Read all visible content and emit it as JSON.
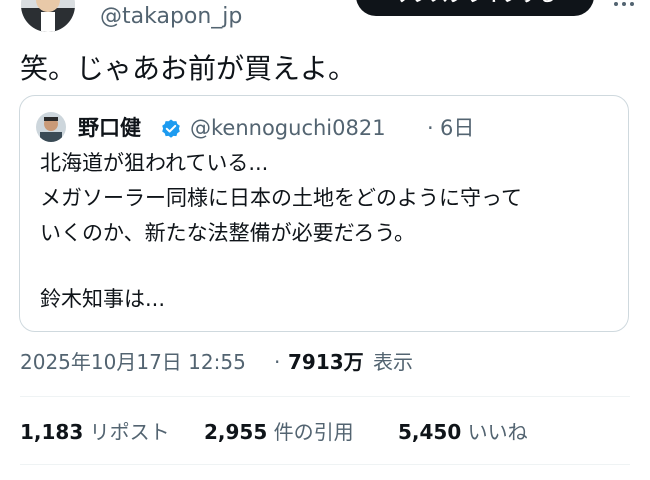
{
  "author": {
    "handle": "@takapon_jp",
    "avatar_icon": "profile-photo"
  },
  "header": {
    "subscribe_label": "サブスクライブする",
    "more_icon": "more-options-icon"
  },
  "tweet": {
    "text": "笑。じゃあお前が買えよ。"
  },
  "quote": {
    "name": "野口健",
    "handle": "@kennoguchi0821",
    "separator": "·",
    "time": "6日",
    "verified_icon": "verified-badge-icon",
    "verified_color": "#1d9bf0",
    "lines": [
      "北海道が狙われている...",
      "メガソーラー同様に日本の土地をどのように守って",
      "いくのか、新たな法整備が必要だろう。",
      "",
      "鈴木知事は..."
    ]
  },
  "meta": {
    "datetime": "2025年10月17日 12:55",
    "separator": "·",
    "views": "7913万",
    "views_label": "表示"
  },
  "stats": {
    "reposts": {
      "count": "1,183",
      "label": "リポスト"
    },
    "quotes": {
      "count": "2,955",
      "label": "件の引用"
    },
    "likes": {
      "count": "5,450",
      "label": "いいね"
    }
  },
  "colors": {
    "text": "#0f1419",
    "secondary": "#536471",
    "border": "#cfd9de",
    "accent": "#1d9bf0"
  }
}
